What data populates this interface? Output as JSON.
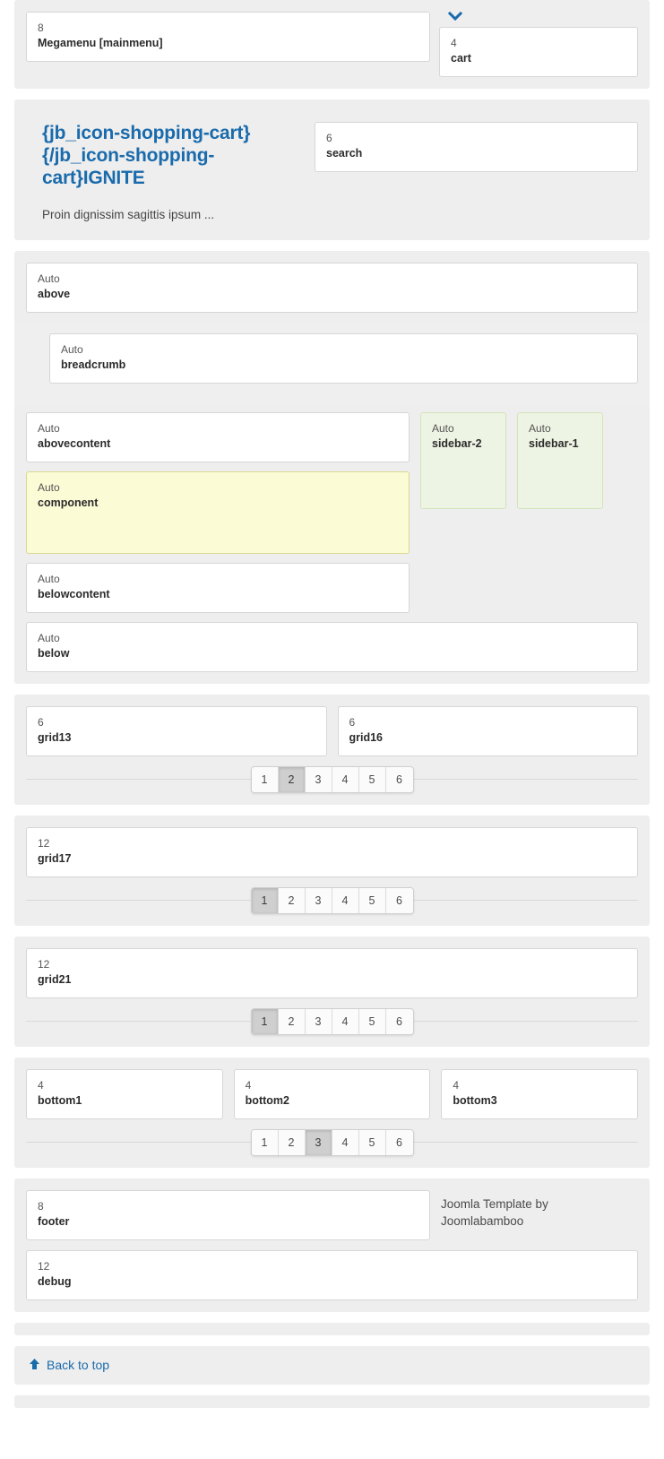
{
  "colors": {
    "accent": "#1a6bac",
    "section_bg": "#eeeeee",
    "block_bg": "#ffffff",
    "sidebar_green": "#edf4e3",
    "component_yellow": "#fbfbd6",
    "pager_active": "#cfcfcf"
  },
  "topbar": {
    "mainmenu": {
      "span": "8",
      "name": "Megamenu [mainmenu]"
    },
    "chevron_icon": "chevron-down-icon",
    "cart": {
      "span": "4",
      "name": "cart"
    }
  },
  "hero": {
    "title": "{jb_icon-shopping-cart}{/jb_icon-shopping-cart}IGNITE",
    "tagline": "Proin dignissim sagittis ipsum ...",
    "search": {
      "span": "Auto",
      "name": "search",
      "span_label": "6"
    }
  },
  "mainbody": {
    "above": {
      "span": "Auto",
      "name": "above"
    },
    "breadcrumb": {
      "span": "Auto",
      "name": "breadcrumb"
    },
    "abovecontent": {
      "span": "Auto",
      "name": "abovecontent"
    },
    "component": {
      "span": "Auto",
      "name": "component"
    },
    "belowcontent": {
      "span": "Auto",
      "name": "belowcontent"
    },
    "below": {
      "span": "Auto",
      "name": "below"
    },
    "sidebar2": {
      "span": "Auto",
      "name": "sidebar-2"
    },
    "sidebar1": {
      "span": "Auto",
      "name": "sidebar-1"
    }
  },
  "grid_sections": [
    {
      "blocks": [
        {
          "span": "6",
          "name": "grid13"
        },
        {
          "span": "6",
          "name": "grid16"
        }
      ],
      "pager": {
        "options": [
          "1",
          "2",
          "3",
          "4",
          "5",
          "6"
        ],
        "active": "2"
      }
    },
    {
      "blocks": [
        {
          "span": "12",
          "name": "grid17"
        }
      ],
      "pager": {
        "options": [
          "1",
          "2",
          "3",
          "4",
          "5",
          "6"
        ],
        "active": "1"
      }
    },
    {
      "blocks": [
        {
          "span": "12",
          "name": "grid21"
        }
      ],
      "pager": {
        "options": [
          "1",
          "2",
          "3",
          "4",
          "5",
          "6"
        ],
        "active": "1"
      }
    },
    {
      "blocks": [
        {
          "span": "4",
          "name": "bottom1"
        },
        {
          "span": "4",
          "name": "bottom2"
        },
        {
          "span": "4",
          "name": "bottom3"
        }
      ],
      "pager": {
        "options": [
          "1",
          "2",
          "3",
          "4",
          "5",
          "6"
        ],
        "active": "3"
      }
    }
  ],
  "footer": {
    "footer_block": {
      "span": "8",
      "name": "footer"
    },
    "credit_line1": "Joomla Template by",
    "credit_line2": "Joomlabamboo",
    "debug_block": {
      "span": "12",
      "name": "debug"
    }
  },
  "backtotop": {
    "icon": "arrow-up-icon",
    "label": "Back to top"
  }
}
